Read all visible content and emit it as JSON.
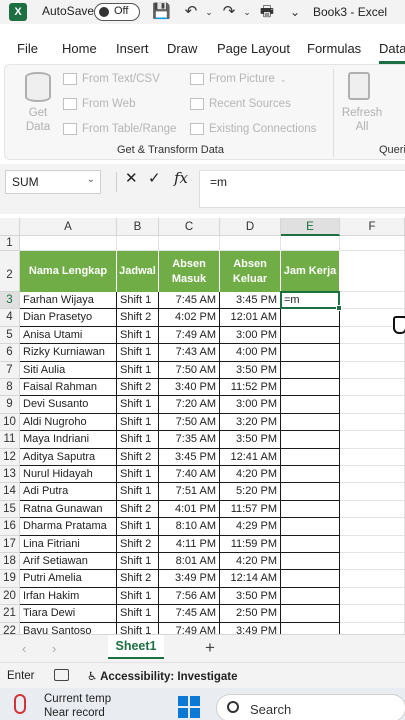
{
  "app": {
    "logo_letter": "X",
    "autosave_label": "AutoSave",
    "autosave_state": "Off",
    "filename": "Book3 - Excel"
  },
  "menu": [
    "File",
    "Home",
    "Insert",
    "Draw",
    "Page Layout",
    "Formulas",
    "Data"
  ],
  "ribbon": {
    "get_data_line1": "Get",
    "get_data_line2": "Data",
    "from_text": "From Text/CSV",
    "from_web": "From Web",
    "from_table": "From Table/Range",
    "from_picture": "From Picture",
    "recent_sources": "Recent Sources",
    "existing_connections": "Existing Connections",
    "refresh_line1": "Refresh",
    "refresh_line2": "All",
    "group_get_transform": "Get & Transform Data",
    "group_queries": "Queri"
  },
  "formula_bar": {
    "name_box": "SUM",
    "cancel_icon": "✕",
    "enter_icon": "✓",
    "fx_label": "fx",
    "formula": "=m"
  },
  "grid": {
    "columns": [
      "A",
      "B",
      "C",
      "D",
      "E",
      "F"
    ],
    "rows": [
      "1",
      "2",
      "3",
      "4",
      "5",
      "6",
      "7",
      "8",
      "9",
      "10",
      "11",
      "12",
      "13",
      "14",
      "15",
      "16",
      "17",
      "18",
      "19",
      "20",
      "21",
      "22"
    ],
    "headers": [
      "Nama Lengkap",
      "Jadwal",
      "Absen Masuk",
      "Absen Keluar",
      "Jam Kerja"
    ],
    "data": [
      [
        "Farhan Wijaya",
        "Shift 1",
        "7:45 AM",
        "3:45 PM",
        "=m"
      ],
      [
        "Dian Prasetyo",
        "Shift 2",
        "4:02 PM",
        "12:01 AM",
        ""
      ],
      [
        "Anisa Utami",
        "Shift 1",
        "7:49 AM",
        "3:00 PM",
        ""
      ],
      [
        "Rizky Kurniawan",
        "Shift 1",
        "7:43 AM",
        "4:00 PM",
        ""
      ],
      [
        "Siti Aulia",
        "Shift 1",
        "7:50 AM",
        "3:50 PM",
        ""
      ],
      [
        "Faisal Rahman",
        "Shift 2",
        "3:40 PM",
        "11:52 PM",
        ""
      ],
      [
        "Devi Susanto",
        "Shift 1",
        "7:20 AM",
        "3:00 PM",
        ""
      ],
      [
        "Aldi Nugroho",
        "Shift 1",
        "7:50 AM",
        "3:20 PM",
        ""
      ],
      [
        "Maya Indriani",
        "Shift 1",
        "7:35 AM",
        "3:50 PM",
        ""
      ],
      [
        "Aditya Saputra",
        "Shift 2",
        "3:45 PM",
        "12:41 AM",
        ""
      ],
      [
        "Nurul Hidayah",
        "Shift 1",
        "7:40 AM",
        "4:20 PM",
        ""
      ],
      [
        "Adi Putra",
        "Shift 1",
        "7:51 AM",
        "5:20 PM",
        ""
      ],
      [
        "Ratna Gunawan",
        "Shift 2",
        "4:01 PM",
        "11:57 PM",
        ""
      ],
      [
        "Dharma Pratama",
        "Shift 1",
        "8:10 AM",
        "4:29 PM",
        ""
      ],
      [
        "Lina Fitriani",
        "Shift 2",
        "4:11 PM",
        "11:59 PM",
        ""
      ],
      [
        "Arif Setiawan",
        "Shift 1",
        "8:01 AM",
        "4:20 PM",
        ""
      ],
      [
        "Putri Amelia",
        "Shift 2",
        "3:49 PM",
        "12:14 AM",
        ""
      ],
      [
        "Irfan Hakim",
        "Shift 1",
        "7:56 AM",
        "3:50 PM",
        ""
      ],
      [
        "Tiara Dewi",
        "Shift 1",
        "7:45 AM",
        "2:50 PM",
        ""
      ],
      [
        "Bayu Santoso",
        "Shift 1",
        "7:49 AM",
        "3:49 PM",
        ""
      ]
    ]
  },
  "sheets": {
    "active": "Sheet1",
    "add_icon": "+"
  },
  "status": {
    "mode": "Enter",
    "accessibility": "Accessibility: Investigate"
  },
  "taskbar": {
    "weather_line1": "Current temp",
    "weather_line2": "Near record",
    "search_label": "Search"
  },
  "colors": {
    "accent": "#1d6f42",
    "header_fill": "#70ad47"
  }
}
